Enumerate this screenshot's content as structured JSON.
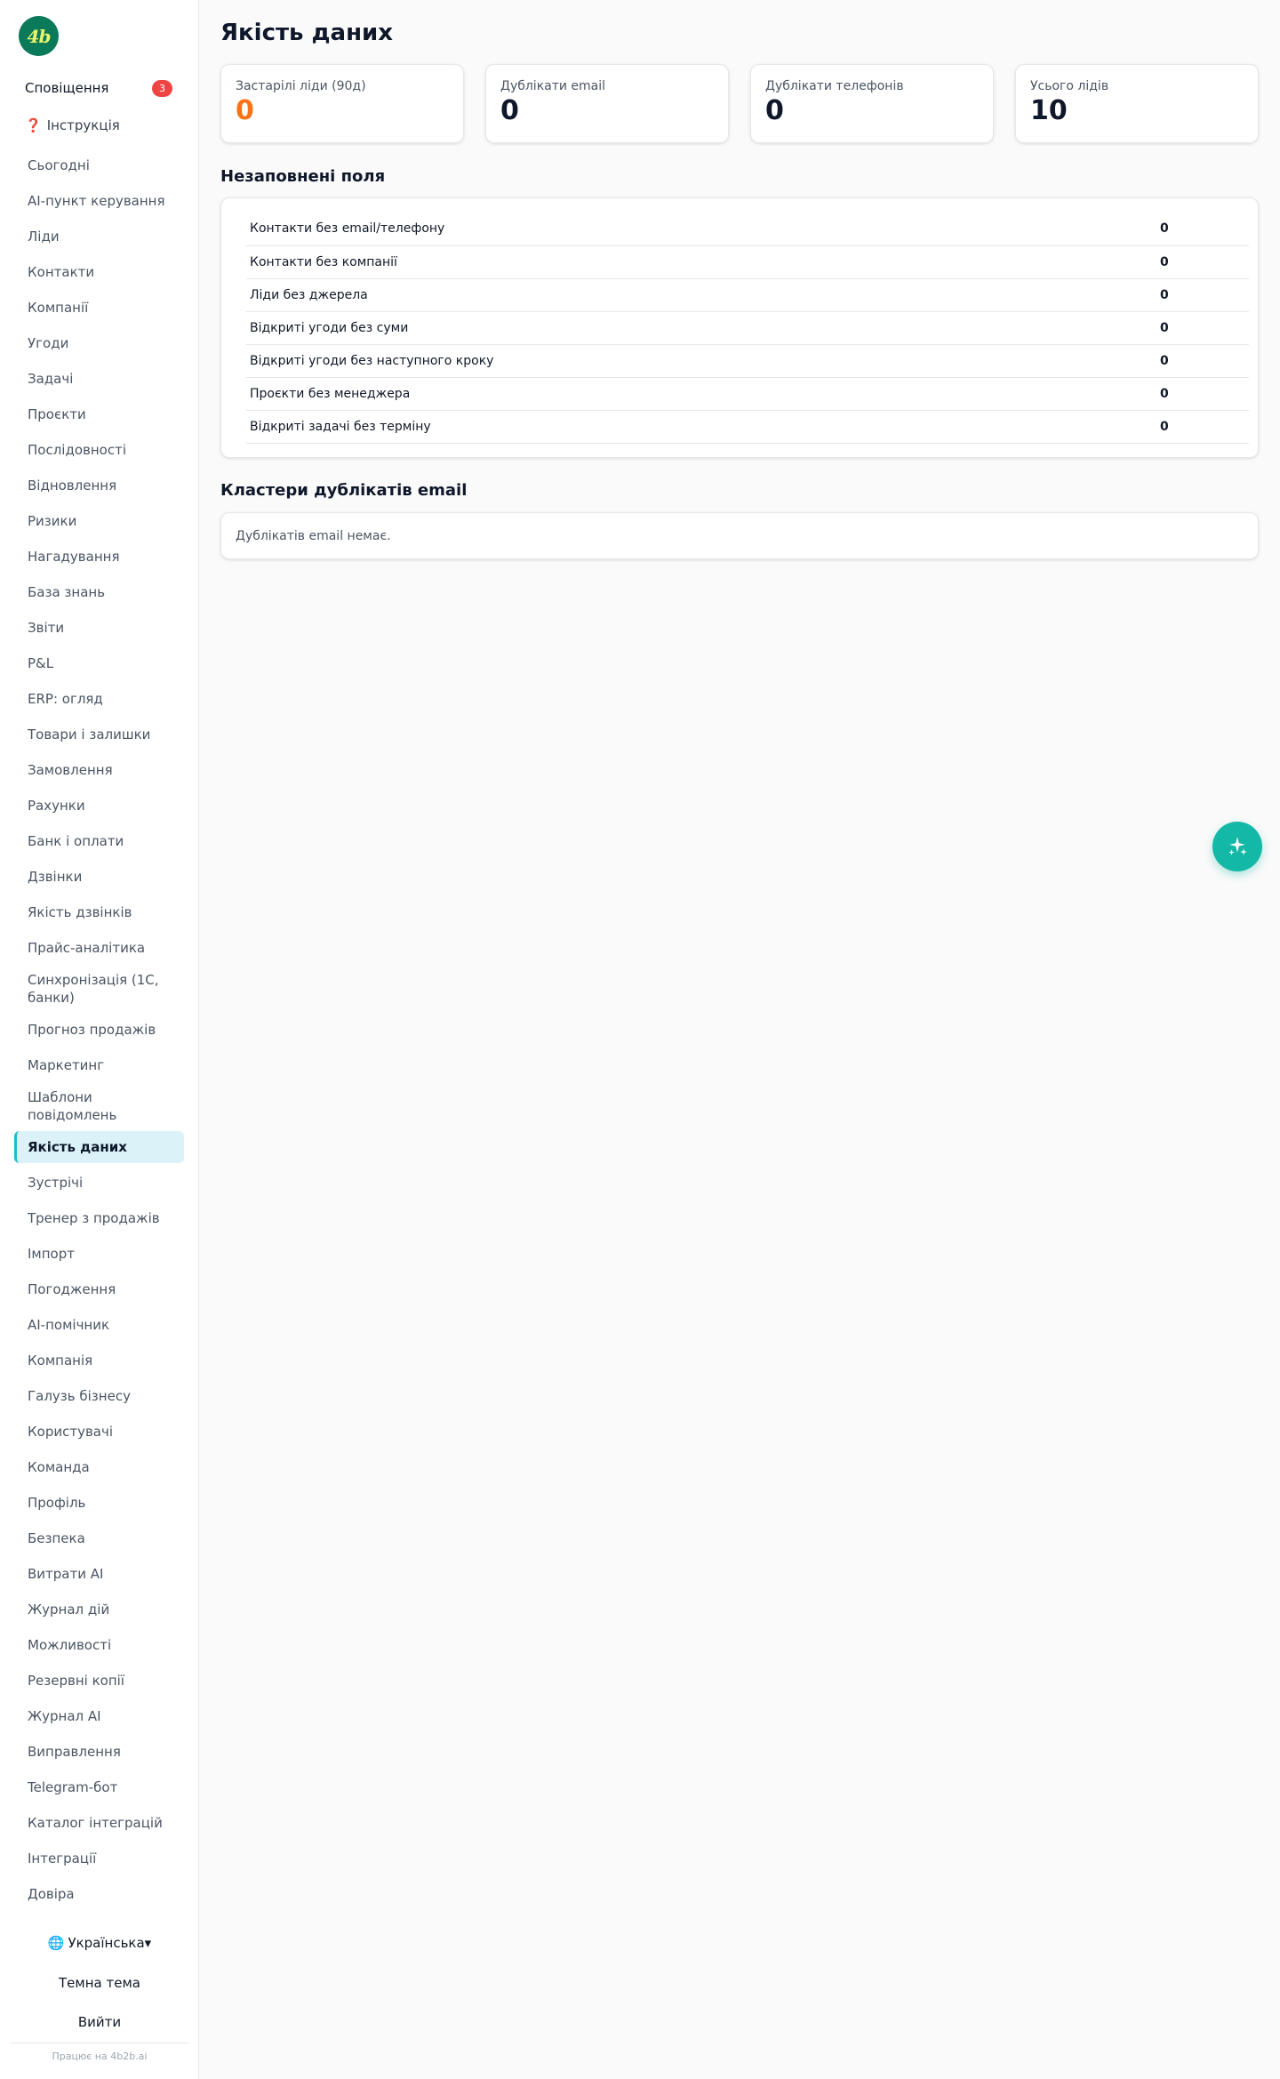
{
  "brand": {
    "logo_text": "4b",
    "logo_bg": "#0b7a5a",
    "logo_fg": "#e9f56b"
  },
  "sidebar": {
    "notifications_label": "Сповіщення",
    "notifications_count": "3",
    "instructions_icon": "❓",
    "instructions_label": "Інструкція",
    "items": [
      {
        "label": "Сьогодні"
      },
      {
        "label": "AI-пункт керування"
      },
      {
        "label": "Ліди"
      },
      {
        "label": "Контакти"
      },
      {
        "label": "Компанії"
      },
      {
        "label": "Угоди"
      },
      {
        "label": "Задачі"
      },
      {
        "label": "Проєкти"
      },
      {
        "label": "Послідовності"
      },
      {
        "label": "Відновлення"
      },
      {
        "label": "Ризики"
      },
      {
        "label": "Нагадування"
      },
      {
        "label": "База знань"
      },
      {
        "label": "Звіти"
      },
      {
        "label": "P&L"
      },
      {
        "label": "ERP: огляд"
      },
      {
        "label": "Товари і залишки"
      },
      {
        "label": "Замовлення"
      },
      {
        "label": "Рахунки"
      },
      {
        "label": "Банк і оплати"
      },
      {
        "label": "Дзвінки"
      },
      {
        "label": "Якість дзвінків"
      },
      {
        "label": "Прайс-аналітика"
      },
      {
        "label": "Синхронізація (1С, банки)"
      },
      {
        "label": "Прогноз продажів"
      },
      {
        "label": "Маркетинг"
      },
      {
        "label": "Шаблони повідомлень"
      },
      {
        "label": "Якість даних",
        "active": true
      },
      {
        "label": "Зустрічі"
      },
      {
        "label": "Тренер з продажів"
      },
      {
        "label": "Імпорт"
      },
      {
        "label": "Погодження"
      },
      {
        "label": "AI-помічник"
      },
      {
        "label": "Компанія"
      },
      {
        "label": "Галузь бізнесу"
      },
      {
        "label": "Користувачі"
      },
      {
        "label": "Команда"
      },
      {
        "label": "Профіль"
      },
      {
        "label": "Безпека"
      },
      {
        "label": "Витрати AI"
      },
      {
        "label": "Журнал дій"
      },
      {
        "label": "Можливості"
      },
      {
        "label": "Резервні копії"
      },
      {
        "label": "Журнал AI"
      },
      {
        "label": "Виправлення"
      },
      {
        "label": "Telegram-бот"
      },
      {
        "label": "Каталог інтеграцій"
      },
      {
        "label": "Інтеграції"
      },
      {
        "label": "Довіра"
      }
    ],
    "language_icon": "🌐",
    "language_label": "Українська▾",
    "theme_label": "Темна тема",
    "logout_label": "Вийти",
    "powered_by": "Працює на 4b2b.ai"
  },
  "page": {
    "title": "Якість даних",
    "stats": [
      {
        "label": "Застарілі ліди (90д)",
        "value": "0",
        "color": "#f97316"
      },
      {
        "label": "Дублікати email",
        "value": "0"
      },
      {
        "label": "Дублікати телефонів",
        "value": "0"
      },
      {
        "label": "Усього лідів",
        "value": "10"
      }
    ],
    "missing_title": "Незаповнені поля",
    "missing_rows": [
      {
        "label": "Контакти без email/телефону",
        "value": "0"
      },
      {
        "label": "Контакти без компанії",
        "value": "0"
      },
      {
        "label": "Ліди без джерела",
        "value": "0"
      },
      {
        "label": "Відкриті угоди без суми",
        "value": "0"
      },
      {
        "label": "Відкриті угоди без наступного кроку",
        "value": "0"
      },
      {
        "label": "Проєкти без менеджера",
        "value": "0"
      },
      {
        "label": "Відкриті задачі без терміну",
        "value": "0"
      }
    ],
    "dupes_title": "Кластери дублікатів email",
    "dupes_empty": "Дублікатів email немає."
  },
  "colors": {
    "accent": "#14b8a6",
    "active_bg": "#dbf2f9",
    "badge": "#ef4444"
  },
  "icons": {
    "fab": "sparkles-icon"
  }
}
